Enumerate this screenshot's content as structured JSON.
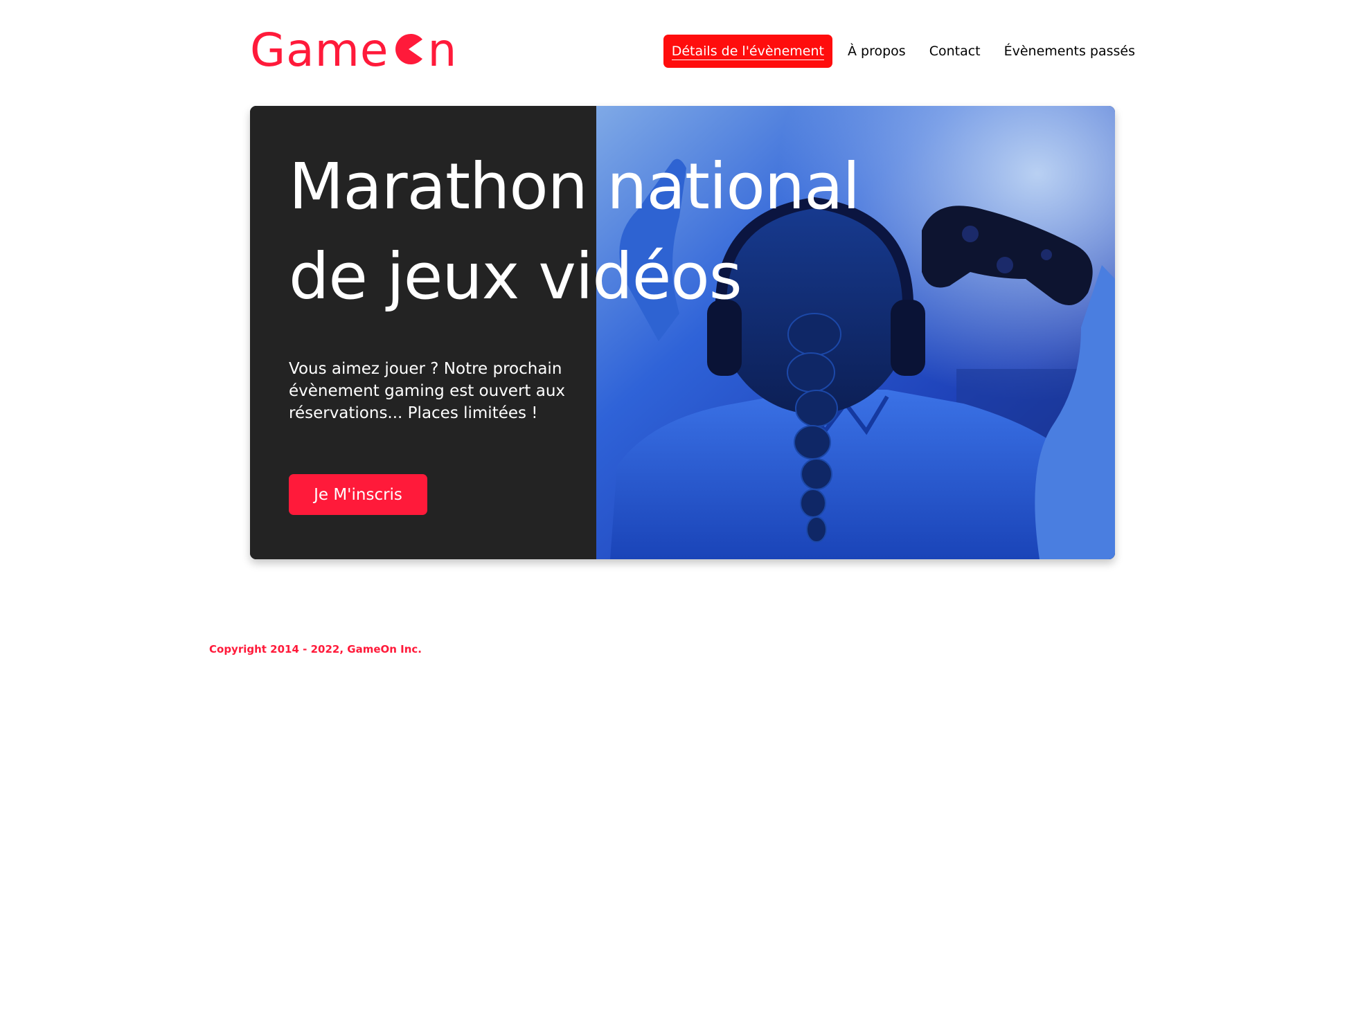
{
  "brand": {
    "logo_text_start": "Game",
    "logo_text_end": "n",
    "logo_icon": "pacman-o-icon",
    "color": "#ff1a3a"
  },
  "nav": {
    "items": [
      {
        "label": "Détails de l'évènement",
        "active": true
      },
      {
        "label": "À propos",
        "active": false
      },
      {
        "label": "Contact",
        "active": false
      },
      {
        "label": "Évènements passés",
        "active": false
      }
    ],
    "active_color": "#ff0d0d"
  },
  "hero": {
    "title_line1": "Marathon national",
    "title_line2": "de jeux vidéos",
    "description": "Vous aimez jouer ? Notre prochain évènement gaming est ouvert aux réservations... Places limitées !",
    "cta_label": "Je M'inscris",
    "image_subject": "gamer-girl-with-headphones-and-controller"
  },
  "footer": {
    "copyright": "Copyright 2014 - 2022, GameOn Inc."
  },
  "colors": {
    "dark_panel": "#232323",
    "accent": "#ff1a3a",
    "image_blue": "#1f4fd6"
  }
}
